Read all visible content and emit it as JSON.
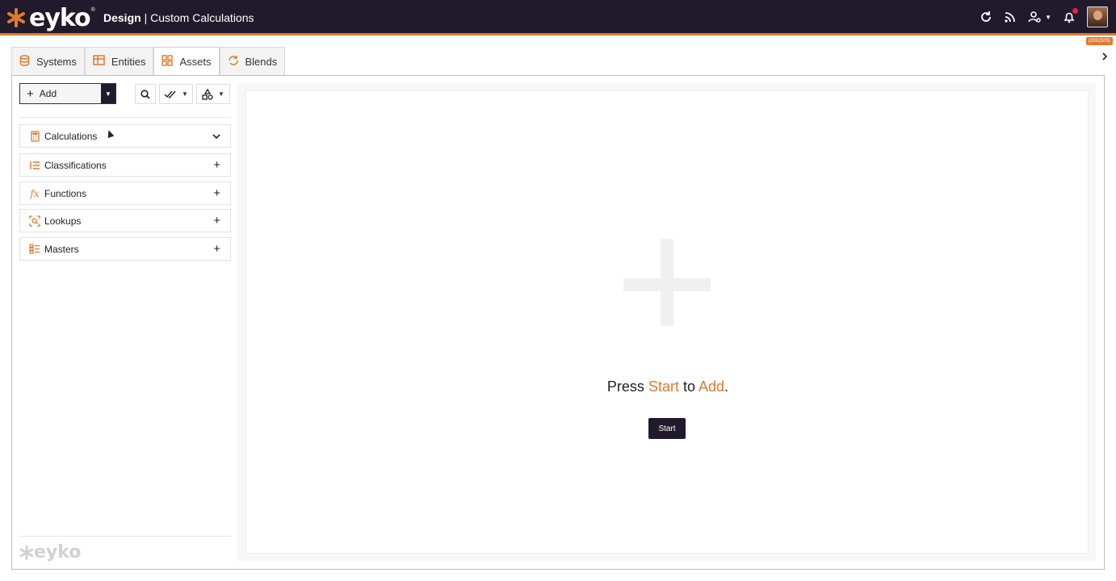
{
  "header": {
    "brand": "eyko",
    "brand_mark": "®",
    "section": "Design",
    "separator": "|",
    "page": "Custom Calculations",
    "version": "(3351505)",
    "icons": [
      "refresh-icon",
      "rss-icon",
      "user-settings-icon",
      "bell-icon",
      "avatar"
    ]
  },
  "tabs": [
    {
      "label": "Systems",
      "icon": "database-icon"
    },
    {
      "label": "Entities",
      "icon": "table-icon"
    },
    {
      "label": "Assets",
      "icon": "grid-icon",
      "active": true
    },
    {
      "label": "Blends",
      "icon": "sync-icon"
    }
  ],
  "sidebar": {
    "add_label": "Add",
    "items": [
      {
        "label": "Calculations",
        "icon": "calculator-icon",
        "action": "chevron-down"
      },
      {
        "label": "Classifications",
        "icon": "list-icon",
        "action": "plus"
      },
      {
        "label": "Functions",
        "icon": "fx-icon",
        "action": "plus"
      },
      {
        "label": "Lookups",
        "icon": "lookup-icon",
        "action": "plus"
      },
      {
        "label": "Masters",
        "icon": "masters-icon",
        "action": "plus"
      }
    ],
    "footer_logo": "eyko"
  },
  "content": {
    "prompt_press": "Press",
    "prompt_start": "Start",
    "prompt_to": "to",
    "prompt_add": "Add",
    "prompt_end": ".",
    "start_button": "Start"
  },
  "colors": {
    "accent": "#e07a2e",
    "header_bg": "#211a2c"
  }
}
